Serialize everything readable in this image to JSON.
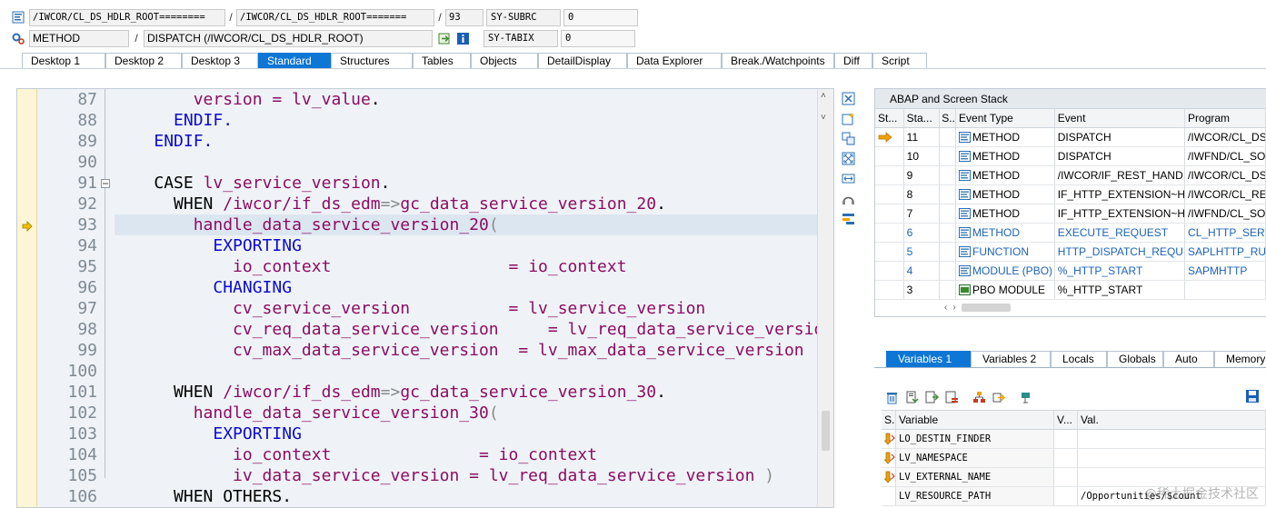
{
  "header": {
    "row1": {
      "field1": "/IWCOR/CL_DS_HDLR_ROOT========",
      "field2": "/IWCOR/CL_DS_HDLR_ROOT=======",
      "line": "93",
      "sys_name": "SY-SUBRC",
      "sys_value": "0"
    },
    "row2": {
      "type": "METHOD",
      "name": "DISPATCH (/IWCOR/CL_DS_HDLR_ROOT)",
      "sys_name": "SY-TABIX",
      "sys_value": "0"
    },
    "separator": "/"
  },
  "tabs": [
    {
      "label": "Desktop 1"
    },
    {
      "label": "Desktop 2"
    },
    {
      "label": "Desktop 3"
    },
    {
      "label": "Standard"
    },
    {
      "label": "Structures"
    },
    {
      "label": "Tables"
    },
    {
      "label": "Objects"
    },
    {
      "label": "DetailDisplay"
    },
    {
      "label": "Data Explorer"
    },
    {
      "label": "Break./Watchpoints"
    },
    {
      "label": "Diff"
    },
    {
      "label": "Script"
    }
  ],
  "active_tab": "Standard",
  "editor": {
    "current_line": "93",
    "line_numbers": [
      "87",
      "88",
      "89",
      "90",
      "91",
      "92",
      "93",
      "94",
      "95",
      "96",
      "97",
      "98",
      "99",
      "100",
      "101",
      "102",
      "103",
      "104",
      "105",
      "106"
    ]
  },
  "stack": {
    "title": "ABAP and Screen Stack",
    "columns": [
      "St...",
      "Sta...",
      "S...",
      "Event Type",
      "Event",
      "Program"
    ],
    "rows": [
      {
        "sta": "11",
        "type": "METHOD",
        "event": "DISPATCH",
        "program": "/IWCOR/CL_DS",
        "blue": false,
        "current": true
      },
      {
        "sta": "10",
        "type": "METHOD",
        "event": "DISPATCH",
        "program": "/IWFND/CL_SO",
        "blue": false,
        "current": false
      },
      {
        "sta": "9",
        "type": "METHOD",
        "event": "/IWCOR/IF_REST_HAND...",
        "program": "/IWCOR/CL_DS",
        "blue": false,
        "current": false
      },
      {
        "sta": "8",
        "type": "METHOD",
        "event": "IF_HTTP_EXTENSION~H...",
        "program": "/IWCOR/CL_RE",
        "blue": false,
        "current": false
      },
      {
        "sta": "7",
        "type": "METHOD",
        "event": "IF_HTTP_EXTENSION~H...",
        "program": "/IWFND/CL_SO",
        "blue": false,
        "current": false
      },
      {
        "sta": "6",
        "type": "METHOD",
        "event": "EXECUTE_REQUEST",
        "program": "CL_HTTP_SERV",
        "blue": true,
        "current": false
      },
      {
        "sta": "5",
        "type": "FUNCTION",
        "event": "HTTP_DISPATCH_REQU...",
        "program": "SAPLHTTP_RU",
        "blue": true,
        "current": false
      },
      {
        "sta": "4",
        "type": "MODULE (PBO)",
        "event": "%_HTTP_START",
        "program": "SAPMHTTP",
        "blue": true,
        "current": false
      },
      {
        "sta": "3",
        "type": "PBO MODULE",
        "event": "%_HTTP_START",
        "program": "",
        "blue": false,
        "current": false
      }
    ]
  },
  "variables": {
    "tabs": [
      {
        "label": "Variables 1"
      },
      {
        "label": "Variables 2"
      },
      {
        "label": "Locals"
      },
      {
        "label": "Globals"
      },
      {
        "label": "Auto"
      },
      {
        "label": "Memory"
      }
    ],
    "columns": [
      "S...",
      "Variable",
      "V...",
      "Val."
    ],
    "rows": [
      {
        "name": "LO_DESTIN_FINDER",
        "value": "",
        "icon": true
      },
      {
        "name": "LV_NAMESPACE",
        "value": "",
        "icon": true
      },
      {
        "name": "LV_EXTERNAL_NAME",
        "value": "",
        "icon": true
      },
      {
        "name": "LV_RESOURCE_PATH",
        "value": "/Opportunities/$count",
        "icon": false
      }
    ]
  },
  "watermark": "@稀土掘金技术社区",
  "colors": {
    "accent": "#0e76d4",
    "keyword": "#0b0bd0",
    "identifier": "#8b0d63",
    "stack_blue": "#1c63b7"
  }
}
